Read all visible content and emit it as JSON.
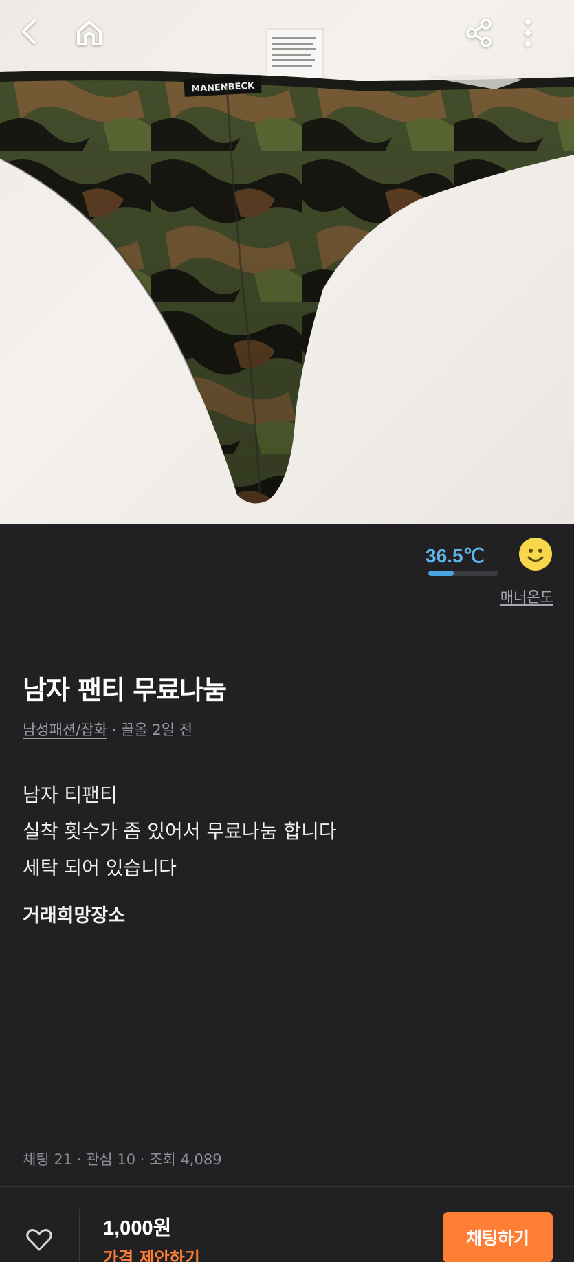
{
  "product": {
    "image_label": "MANENBECK",
    "title": "남자 팬티 무료나눔",
    "category": "남성패션/잡화",
    "bumped": "끌올 2일 전",
    "description": [
      "남자 티팬티",
      "실착 횟수가 좀 있어서 무료나눔 합니다",
      "세탁 되어 있습니다"
    ],
    "place_label": "거래희망장소",
    "stats": "채팅 21 · 관심 10 · 조회 4,089"
  },
  "seller": {
    "temperature": "36.5℃",
    "temperature_level": 0.365,
    "manner_label": "매너온도",
    "face_icon": "smile-face-icon"
  },
  "bottom_bar": {
    "price": "1,000원",
    "offer_label": "가격 제안하기",
    "chat_button": "채팅하기"
  },
  "colors": {
    "background": "#212124",
    "accent": "#ff7e36",
    "temperature": "#5fb4ea"
  },
  "icons": [
    "back-arrow-icon",
    "home-icon",
    "share-icon",
    "more-vertical-icon",
    "heart-icon"
  ]
}
